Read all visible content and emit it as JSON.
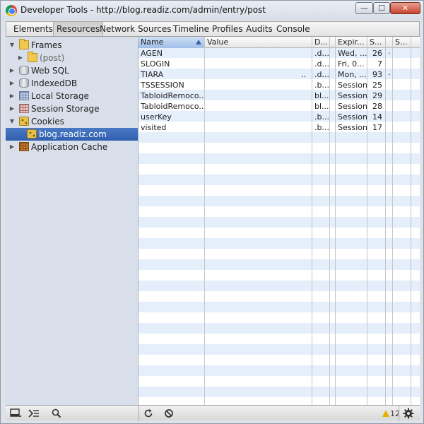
{
  "window": {
    "title": "Developer Tools - http://blog.readiz.com/admin/entry/post",
    "min_glyph": "—",
    "max_glyph": "☐",
    "close_glyph": "✕"
  },
  "tabs": [
    "Elements",
    "Resources",
    "Network",
    "Sources",
    "Timeline",
    "Profiles",
    "Audits",
    "Console"
  ],
  "active_tab": "Resources",
  "sidebar": {
    "items": [
      {
        "label": "Frames",
        "expanded": true,
        "icon": "folder-icon"
      },
      {
        "label": "(post)",
        "expanded": false,
        "icon": "folder-icon"
      },
      {
        "label": "Web SQL",
        "expanded": false,
        "icon": "database-icon"
      },
      {
        "label": "IndexedDB",
        "expanded": false,
        "icon": "database-icon"
      },
      {
        "label": "Local Storage",
        "expanded": false,
        "icon": "storage-grid-icon"
      },
      {
        "label": "Session Storage",
        "expanded": false,
        "icon": "storage-grid-icon"
      },
      {
        "label": "Cookies",
        "expanded": true,
        "icon": "cookie-icon"
      },
      {
        "label": "blog.readiz.com",
        "selected": true,
        "icon": "cookie-icon"
      },
      {
        "label": "Application Cache",
        "expanded": false,
        "icon": "app-cache-icon"
      }
    ]
  },
  "cookie_table": {
    "columns": [
      "Name",
      "Value",
      "D...",
      "",
      "Expir...",
      "S...",
      "",
      "S..."
    ],
    "rows": [
      {
        "name": "AGEN",
        "value": "",
        "domain": ".d...",
        "expires": "Wed, ...",
        "size": "26",
        "extra": "·"
      },
      {
        "name": "SLOGIN",
        "value": "",
        "domain": ".d...",
        "expires": "Fri, 0...",
        "size": "7",
        "extra": ""
      },
      {
        "name": "TIARA",
        "value": "..",
        "domain": ".d...",
        "expires": "Mon, ...",
        "size": "93",
        "extra": "·"
      },
      {
        "name": "TSSESSION",
        "value": "",
        "domain": ".b...",
        "expires": "Session",
        "size": "25",
        "extra": ""
      },
      {
        "name": "TabloidRemoco...",
        "value": "",
        "domain": "bl...",
        "expires": "Session",
        "size": "29",
        "extra": ""
      },
      {
        "name": "TabloidRemoco...",
        "value": "",
        "domain": "bl...",
        "expires": "Session",
        "size": "28",
        "extra": ""
      },
      {
        "name": "userKey",
        "value": "",
        "domain": ".b...",
        "expires": "Session",
        "size": "14",
        "extra": ""
      },
      {
        "name": "visited",
        "value": "",
        "domain": ".b...",
        "expires": "Session",
        "size": "17",
        "extra": ""
      }
    ]
  },
  "statusbar": {
    "warning_count": "12"
  }
}
